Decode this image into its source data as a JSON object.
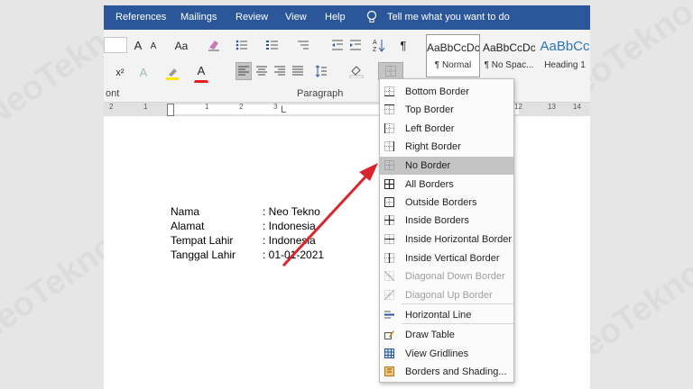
{
  "menubar": {
    "items": [
      "References",
      "Mailings",
      "Review",
      "View",
      "Help"
    ],
    "tell_me": "Tell me what you want to do"
  },
  "ribbon": {
    "font_group_label": "ont",
    "paragraph_group_label": "Paragraph",
    "font_size_button": "A",
    "change_case": "Aa",
    "subscript": "x²",
    "styles": [
      {
        "preview": "AaBbCcDc",
        "name": "¶ Normal"
      },
      {
        "preview": "AaBbCcDc",
        "name": "¶ No Spac..."
      },
      {
        "preview": "AaBbCc",
        "name": "Heading 1"
      }
    ]
  },
  "ruler": {
    "left_numbers": [
      "2",
      "1",
      "1",
      "1",
      "2",
      "3"
    ],
    "right_numbers": [
      "12",
      "13",
      "14"
    ],
    "left_marker": "L"
  },
  "document": {
    "rows": [
      {
        "label": "Nama",
        "value": ": Neo Tekno"
      },
      {
        "label": "Alamat",
        "value": ": Indonesia"
      },
      {
        "label": "Tempat Lahir",
        "value": ": Indonesia"
      },
      {
        "label": "Tanggal Lahir",
        "value": ": 01-01-2021"
      }
    ]
  },
  "border_menu": {
    "items": [
      {
        "label": "Bottom Border",
        "icon": "bottom-border-icon",
        "disabled": false
      },
      {
        "label": "Top Border",
        "icon": "top-border-icon",
        "disabled": false
      },
      {
        "label": "Left Border",
        "icon": "left-border-icon",
        "disabled": false
      },
      {
        "label": "Right Border",
        "icon": "right-border-icon",
        "disabled": false
      },
      {
        "label": "No Border",
        "icon": "no-border-icon",
        "disabled": false,
        "highlighted": true
      },
      {
        "label": "All Borders",
        "icon": "all-borders-icon",
        "disabled": false
      },
      {
        "label": "Outside Borders",
        "icon": "outside-borders-icon",
        "disabled": false
      },
      {
        "label": "Inside Borders",
        "icon": "inside-borders-icon",
        "disabled": false
      },
      {
        "label": "Inside Horizontal Border",
        "icon": "inside-horizontal-border-icon",
        "disabled": false
      },
      {
        "label": "Inside Vertical Border",
        "icon": "inside-vertical-border-icon",
        "disabled": false
      },
      {
        "label": "Diagonal Down Border",
        "icon": "diagonal-down-border-icon",
        "disabled": true
      },
      {
        "label": "Diagonal Up Border",
        "icon": "diagonal-up-border-icon",
        "disabled": true
      },
      {
        "label": "Horizontal Line",
        "icon": "horizontal-line-icon",
        "disabled": false
      },
      {
        "label": "Draw Table",
        "icon": "draw-table-icon",
        "disabled": false
      },
      {
        "label": "View Gridlines",
        "icon": "view-gridlines-icon",
        "disabled": false
      },
      {
        "label": "Borders and Shading...",
        "icon": "borders-shading-icon",
        "disabled": false
      }
    ]
  },
  "watermark": "NeoTekno",
  "colors": {
    "title_bar": "#2b579a",
    "arrow": "#d9262c",
    "font_color": "#e02020",
    "highlight_color": "#ffe600"
  }
}
